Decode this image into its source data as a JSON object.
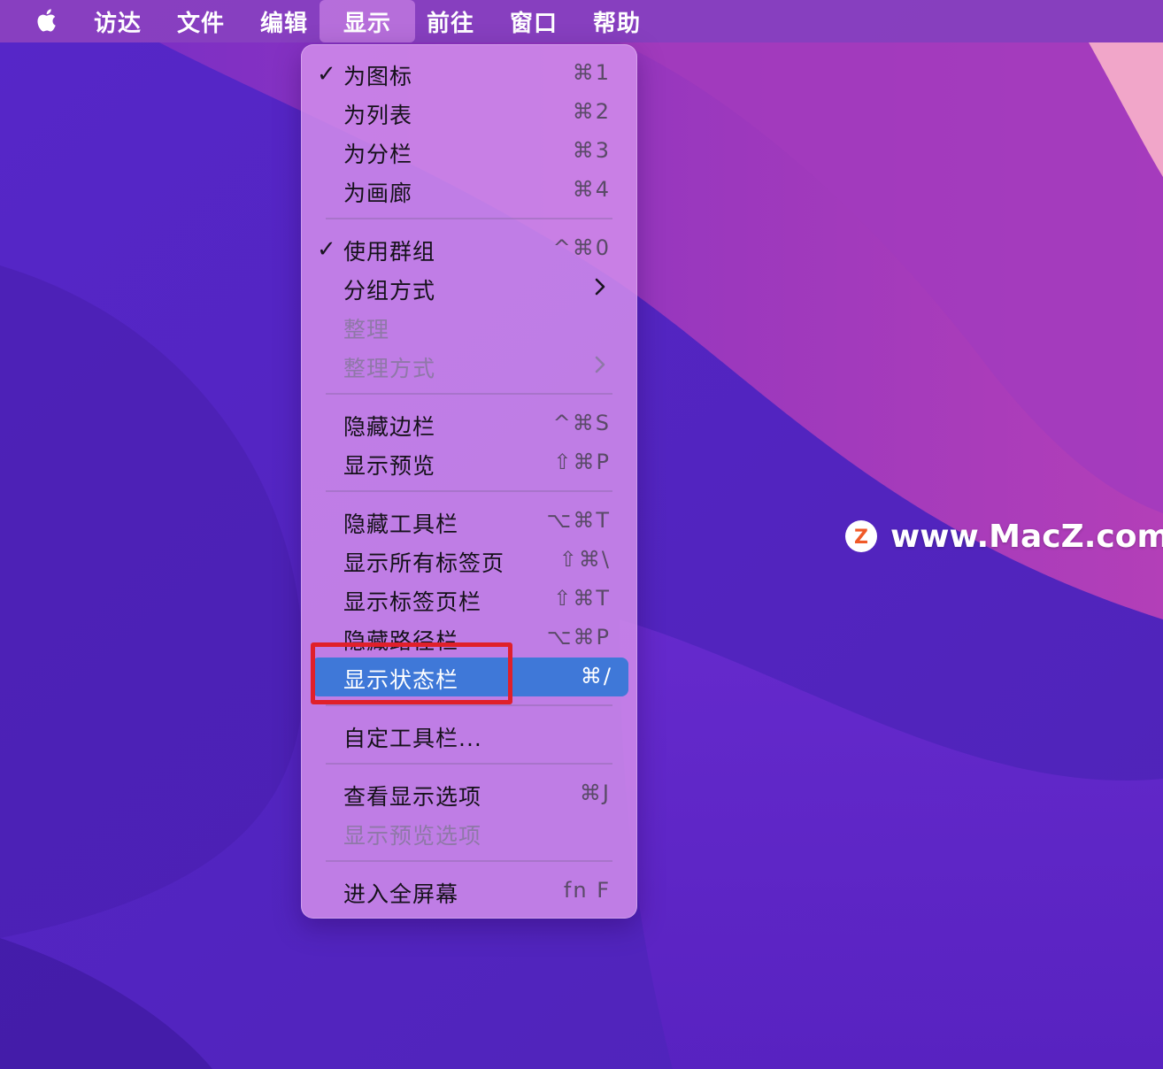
{
  "menubar": {
    "items": [
      {
        "label": "访达"
      },
      {
        "label": "文件"
      },
      {
        "label": "编辑"
      },
      {
        "label": "显示"
      },
      {
        "label": "前往"
      },
      {
        "label": "窗口"
      },
      {
        "label": "帮助"
      }
    ],
    "active_item": "显示"
  },
  "view_menu": {
    "items": [
      {
        "label": "为图标",
        "shortcut": "⌘1",
        "checked": true
      },
      {
        "label": "为列表",
        "shortcut": "⌘2"
      },
      {
        "label": "为分栏",
        "shortcut": "⌘3"
      },
      {
        "label": "为画廊",
        "shortcut": "⌘4"
      },
      {
        "label": "使用群组",
        "shortcut": "^⌘0",
        "checked": true
      },
      {
        "label": "分组方式",
        "submenu": true
      },
      {
        "label": "整理",
        "disabled": true
      },
      {
        "label": "整理方式",
        "submenu": true,
        "disabled": true
      },
      {
        "label": "隐藏边栏",
        "shortcut": "^⌘S"
      },
      {
        "label": "显示预览",
        "shortcut": "⇧⌘P"
      },
      {
        "label": "隐藏工具栏",
        "shortcut": "⌥⌘T"
      },
      {
        "label": "显示所有标签页",
        "shortcut": "⇧⌘\\"
      },
      {
        "label": "显示标签页栏",
        "shortcut": "⇧⌘T"
      },
      {
        "label": "隐藏路径栏",
        "shortcut": "⌥⌘P"
      },
      {
        "label": "显示状态栏",
        "shortcut": "⌘/",
        "selected": true
      },
      {
        "label": "自定工具栏..."
      },
      {
        "label": "查看显示选项",
        "shortcut": "⌘J"
      },
      {
        "label": "显示预览选项",
        "disabled": true
      },
      {
        "label": "进入全屏幕",
        "shortcut": "fn F"
      }
    ]
  },
  "check_glyph": "✓",
  "watermark": {
    "text": "www.MacZ.com",
    "logo_letter": "Z"
  },
  "icons": {
    "apple": "apple-logo-icon",
    "check": "checkmark-icon",
    "submenu": "chevron-right-icon",
    "watermark": "macz-logo-icon"
  },
  "colors": {
    "selection": "#3f78d8",
    "highlight_box": "#e0202a",
    "menu_background": "#d28ceb",
    "menubar_background": "#9646be"
  }
}
